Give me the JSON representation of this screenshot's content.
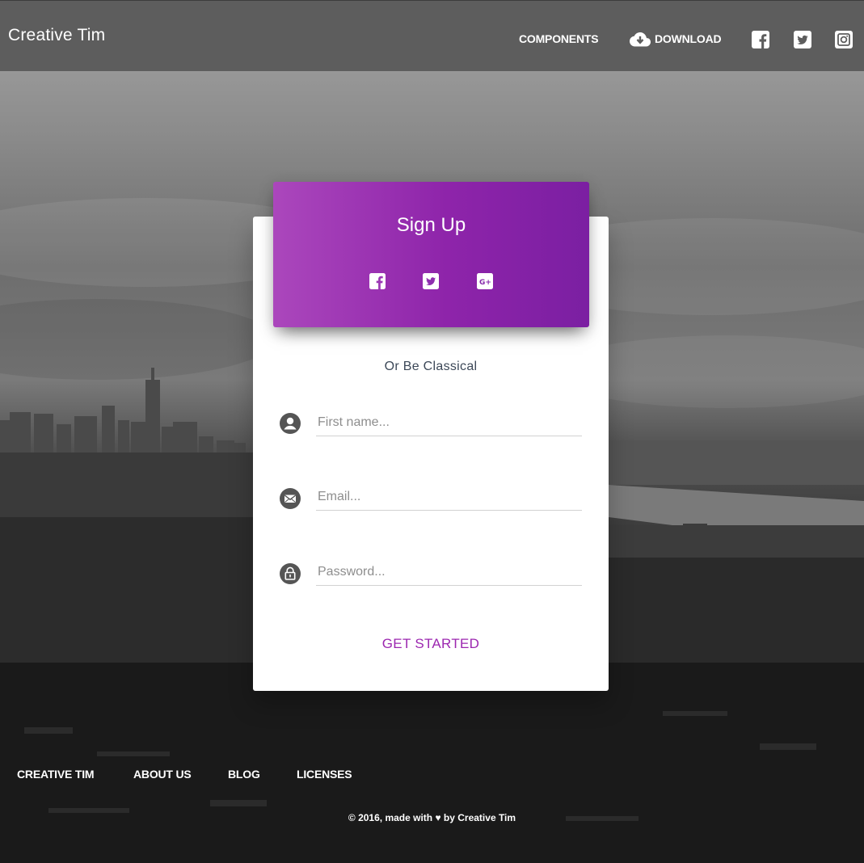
{
  "navbar": {
    "brand": "Creative Tim",
    "components_label": "COMPONENTS",
    "download_label": "DOWNLOAD",
    "social_icons": [
      "facebook-square-icon",
      "twitter-square-icon",
      "instagram-icon"
    ]
  },
  "card": {
    "title": "Sign Up",
    "social_buttons": [
      "facebook-icon",
      "twitter-icon",
      "google-plus-icon"
    ],
    "divider_text": "Or Be Classical",
    "fields": {
      "first_name": {
        "placeholder": "First name...",
        "value": "",
        "icon": "face-icon"
      },
      "email": {
        "placeholder": "Email...",
        "value": "",
        "icon": "email-icon"
      },
      "password": {
        "placeholder": "Password...",
        "value": "",
        "icon": "lock-icon"
      }
    },
    "cta_label": "GET STARTED"
  },
  "footer": {
    "links": [
      "CREATIVE TIM",
      "ABOUT US",
      "BLOG",
      "LICENSES"
    ],
    "copyright": "© 2016, made with ♥ by Creative Tim"
  },
  "colors": {
    "accent": "#9c27b0",
    "header_gradient_start": "#ab47bc",
    "header_gradient_end": "#7b1fa2",
    "navbar": "#5d5d5d"
  }
}
